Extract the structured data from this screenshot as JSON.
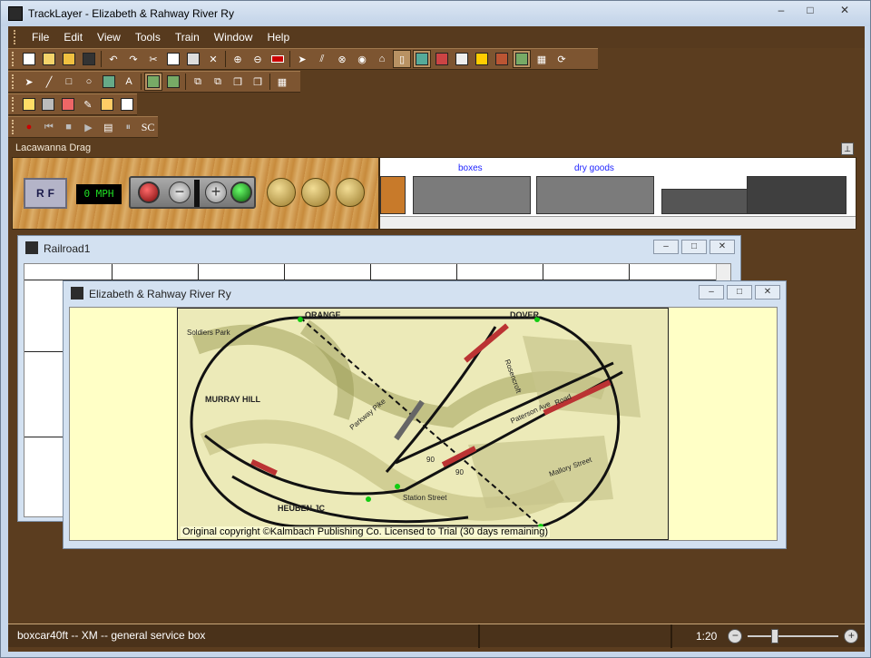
{
  "window": {
    "title": "TrackLayer - Elizabeth & Rahway River Ry",
    "minimize": "–",
    "maximize": "□",
    "close": "✕"
  },
  "menu": [
    "File",
    "Edit",
    "View",
    "Tools",
    "Train",
    "Window",
    "Help"
  ],
  "toolbars": {
    "row1_icons": [
      "new-icon",
      "open-icon",
      "open-folder-icon",
      "save-icon",
      "undo-icon",
      "redo-icon",
      "cut-icon",
      "copy-icon",
      "paste-icon",
      "delete-icon",
      "zoom-in-icon",
      "zoom-out-icon",
      "zoom-fit-icon",
      "select-arrow-icon",
      "track-tool-icon",
      "turnout-icon",
      "turntable-icon",
      "building-icon",
      "signal-icon",
      "layer1-icon",
      "layer2-icon",
      "layer3-icon",
      "layer4-icon",
      "layer5-icon",
      "terrain-icon",
      "grid-icon",
      "refresh-icon"
    ],
    "row2_icons": [
      "pointer-icon",
      "line-icon",
      "rectangle-icon",
      "ellipse-icon",
      "image-icon",
      "text-icon",
      "terrain-a-icon",
      "terrain-b-icon",
      "align-icon",
      "group-icon",
      "front-icon",
      "back-icon",
      "grid-view-icon"
    ],
    "row3_icons": [
      "add-car-icon",
      "remove-car-icon",
      "delete-car-icon",
      "edit-car-icon",
      "car-props-icon",
      "car-list-icon"
    ],
    "row4": {
      "record_icon": "record-icon",
      "rewind_icon": "rewind-icon",
      "stop_icon": "stop-icon",
      "play_icon": "play-icon",
      "list_icon": "list-icon",
      "pause_icon": "pause-icon",
      "sc_label": "SC"
    }
  },
  "train_panel": {
    "name": "Lacawanna Drag",
    "r_label": "R",
    "f_label": "F",
    "speed": "0 MPH",
    "minus": "−",
    "plus": "+",
    "cars": [
      "boxes",
      "dry goods"
    ]
  },
  "railroad1": {
    "title": "Railroad1"
  },
  "main_window": {
    "title": "Elizabeth & Rahway River Ry",
    "copyright": "Original copyright ©Kalmbach Publishing Co.  Licensed to Trial (30 days remaining)",
    "map_labels": [
      "ORANGE",
      "DOVER",
      "Soldiers Park",
      "MURRAY HILL",
      "HEUBEN JC",
      "Station Street",
      "Mallory Street",
      "Paterson Ave",
      "Parkway Pike",
      "Rosencroft",
      "Road"
    ],
    "track_numbers": [
      "90",
      "90"
    ]
  },
  "status": {
    "message": "boxcar40ft -- XM -- general service box",
    "zoom": "1:20",
    "zoom_level": 0.28
  }
}
